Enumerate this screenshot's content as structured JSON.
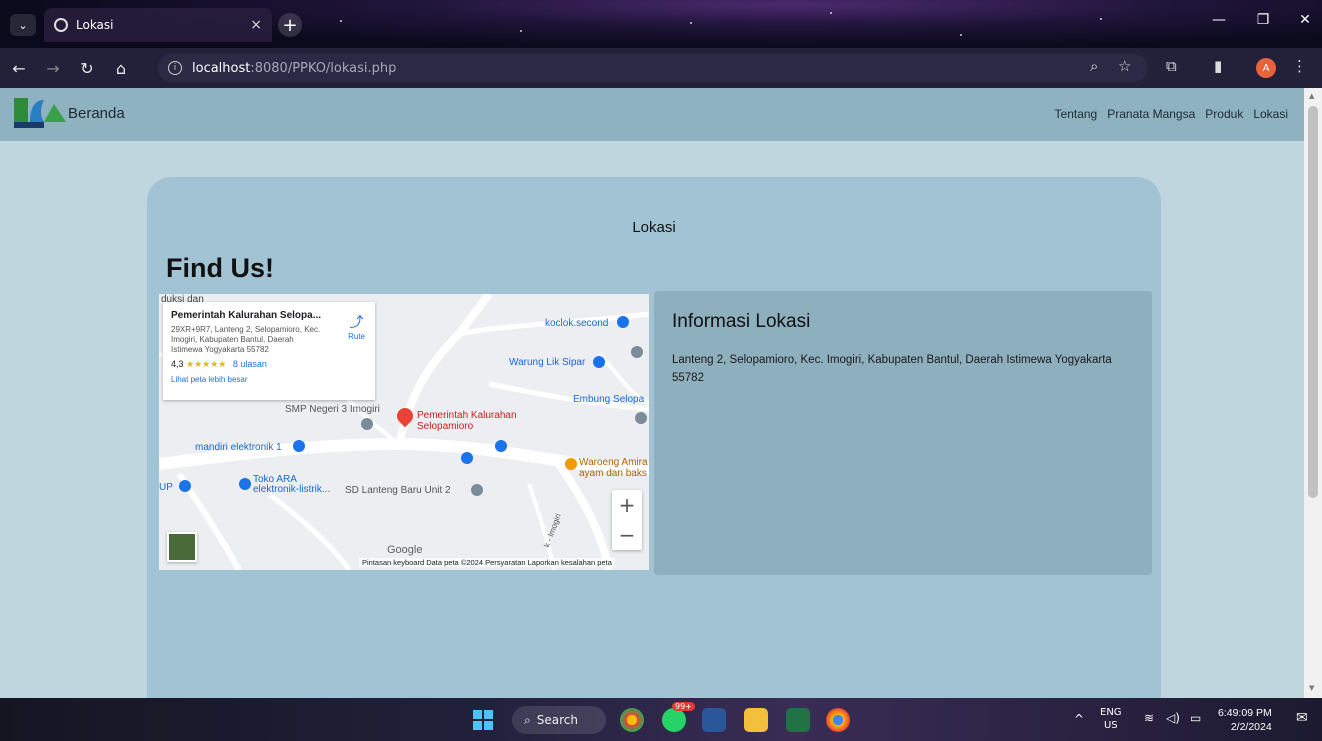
{
  "browser": {
    "tab_title": "Lokasi",
    "tab_close": "×",
    "new_tab": "+",
    "url_host": "localhost",
    "url_rest": ":8080/PPKO/lokasi.php",
    "window_controls": {
      "minimize": "—",
      "restore": "❐",
      "close": "✕"
    },
    "avatar_letter": "A"
  },
  "navbar": {
    "brand": "Beranda",
    "links": [
      "Tentang",
      "Pranata Mangsa",
      "Produk",
      "Lokasi"
    ]
  },
  "page": {
    "heading": "Lokasi",
    "find_us": "Find Us!"
  },
  "map": {
    "infocard": {
      "title": "Pemerintah Kalurahan Selopa...",
      "address": "29XR+9R7, Lanteng 2, Selopamioro, Kec. Imogiri, Kabupaten Bantul, Daerah Istimewa Yogyakarta 55782",
      "rating": "4,3",
      "stars": "★★★★★",
      "reviews": "8 ulasan",
      "larger_map_link": "Lihat peta lebih besar",
      "route_label": "Rute"
    },
    "labels": {
      "top_left": "duksi dan",
      "koclok": "koclok.second",
      "warung": "Warung Lik Sipar",
      "embung": "Embung Selopa",
      "smp": "SMP Negeri 3 Imogiri",
      "pemerintah_line1": "Pemerintah Kalurahan",
      "pemerintah_line2": "Selopamioro",
      "mandiri": "mandiri elektronik 1",
      "waroeng_line1": "Waroeng Amira",
      "waroeng_line2": "ayam dan baks",
      "toko_line1": "Toko ARA",
      "toko_line2": "elektronik-listrik...",
      "sd": "SD Lanteng Baru Unit 2",
      "up": "UP",
      "imogiri_road": "k - Imogiri"
    },
    "zoom_in": "+",
    "zoom_out": "−",
    "google": "Google",
    "attribution": "Pintasan keyboard   Data peta ©2024   Persyaratan   Laporkan kesalahan peta"
  },
  "info_panel": {
    "title": "Informasi Lokasi",
    "address": "Lanteng 2, Selopamioro, Kec. Imogiri, Kabupaten Bantul, Daerah Istimewa Yogyakarta 55782"
  },
  "taskbar": {
    "search_label": "Search",
    "badge": "99+",
    "lang_line1": "ENG",
    "lang_line2": "US",
    "time": "6:49:09 PM",
    "date": "2/2/2024"
  },
  "colors": {
    "navbar": "#8fb2c1",
    "page_bg": "#bfd6de",
    "card_bg": "#a2c3d4",
    "info_panel": "#8eafbd",
    "map_pin": "#ea4335"
  }
}
